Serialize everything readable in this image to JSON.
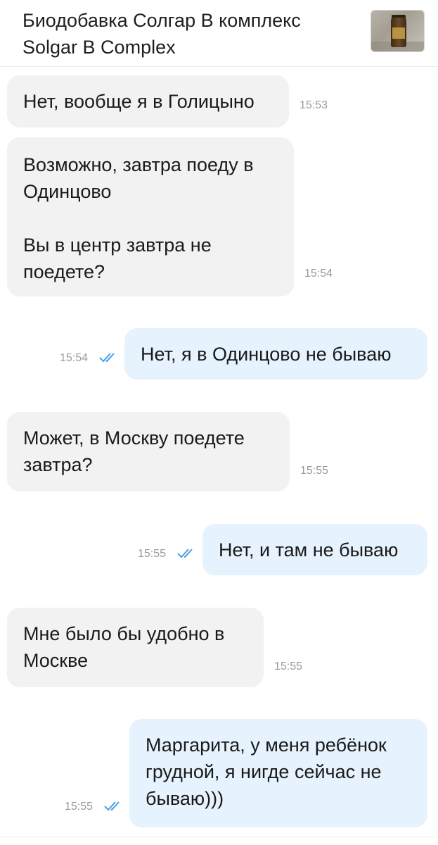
{
  "header": {
    "title": "Биодобавка Солгар В комплекс\nSolgar B Complex",
    "thumbnail": "product-photo"
  },
  "messages": [
    {
      "direction": "in",
      "text": "Нет, вообще я в Голицыно",
      "time": "15:53"
    },
    {
      "direction": "in",
      "text": "Возможно, завтра поеду в\nОдинцово\n\nВы в центр завтра не\nпоедете?",
      "time": "15:54"
    },
    {
      "direction": "out",
      "text": "Нет, я в Одинцово не бываю",
      "time": "15:54",
      "status": "read"
    },
    {
      "direction": "in",
      "text": "Может, в Москву поедете\nзавтра?",
      "time": "15:55"
    },
    {
      "direction": "out",
      "text": "Нет, и там не бываю",
      "time": "15:55",
      "status": "read"
    },
    {
      "direction": "in",
      "text": "Мне было бы удобно в\nМоскве",
      "time": "15:55"
    },
    {
      "direction": "out",
      "text": "Маргарита, у меня ребёнок\nгрудной, я нигде сейчас не\nбываю)))",
      "time": "15:55",
      "status": "read"
    }
  ],
  "colors": {
    "incoming_bubble": "#f2f2f2",
    "outgoing_bubble": "#e6f2fd",
    "read_check": "#4a9fe8",
    "time_text": "#9a9a9a"
  }
}
